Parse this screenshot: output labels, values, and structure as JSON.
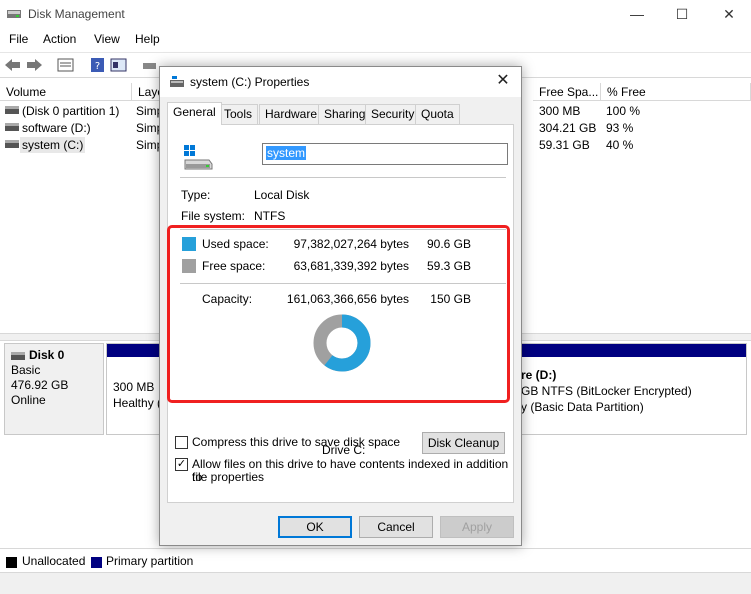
{
  "app": {
    "title": "Disk Management"
  },
  "window_controls": {
    "minimize": "—",
    "maximize": "☐",
    "close": "✕"
  },
  "menu": [
    "File",
    "Action",
    "View",
    "Help"
  ],
  "volumes": {
    "columns": [
      "Volume",
      "Layo",
      "Free Spa...",
      "% Free"
    ],
    "rows": [
      {
        "volume": "(Disk 0 partition 1)",
        "layout": "Simp",
        "free": "300 MB",
        "pct": "100 %"
      },
      {
        "volume": "software (D:)",
        "layout": "Simp",
        "free": "304.21 GB",
        "pct": "93 %"
      },
      {
        "volume": "system (C:)",
        "layout": "Simp",
        "free": "59.31 GB",
        "pct": "40 %"
      }
    ]
  },
  "disk0": {
    "name": "Disk 0",
    "type": "Basic",
    "size": "476.92 GB",
    "status": "Online",
    "partitions": [
      {
        "line1": "300 MB",
        "line2": "Healthy ("
      },
      {
        "line1": "re  (D:)",
        "line2": "GB NTFS (BitLocker Encrypted)",
        "line3": "y (Basic Data Partition)"
      }
    ]
  },
  "legend": [
    {
      "label": "Unallocated",
      "color": "#000000"
    },
    {
      "label": "Primary partition",
      "color": "#000080"
    }
  ],
  "dialog": {
    "title": "system (C:) Properties",
    "close": "✕",
    "tabs": [
      "General",
      "Tools",
      "Hardware",
      "Sharing",
      "Security",
      "Quota"
    ],
    "active_tab": "General",
    "drive_name": "system",
    "type_label": "Type:",
    "type_value": "Local Disk",
    "fs_label": "File system:",
    "fs_value": "NTFS",
    "used": {
      "label": "Used space:",
      "bytes": "97,382,027,264 bytes",
      "gb": "90.6 GB",
      "color": "#26a0da"
    },
    "free": {
      "label": "Free space:",
      "bytes": "63,681,339,392 bytes",
      "gb": "59.3 GB",
      "color": "#a0a0a0"
    },
    "capacity": {
      "label": "Capacity:",
      "bytes": "161,063,366,656 bytes",
      "gb": "150 GB"
    },
    "used_fraction": 0.605,
    "drive_caption": "Drive C:",
    "disk_cleanup": "Disk Cleanup",
    "compress_label": "Compress this drive to save disk space",
    "compress_checked": false,
    "index_label_1": "Allow files on this drive to have contents indexed in addition to",
    "index_label_2": "file properties",
    "index_checked": true,
    "ok": "OK",
    "cancel": "Cancel",
    "apply": "Apply"
  }
}
